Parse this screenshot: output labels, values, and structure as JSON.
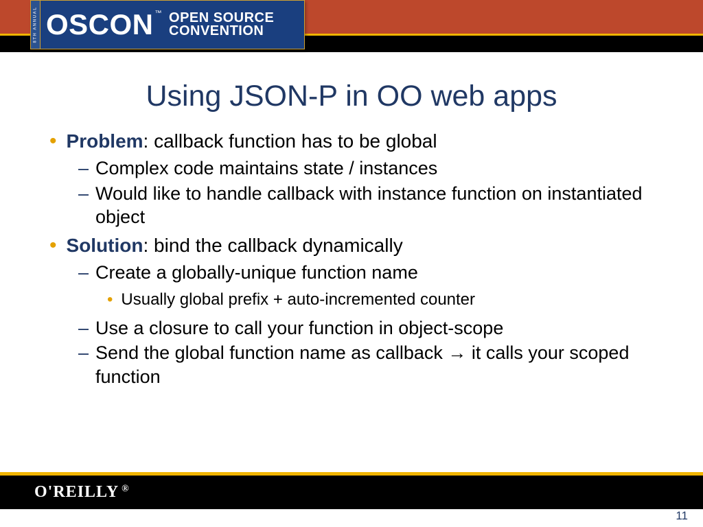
{
  "header": {
    "annual": "8TH ANNUAL",
    "logo_main": "OSCON",
    "logo_tm": "™",
    "logo_line1": "OPEN SOURCE",
    "logo_line2": "CONVENTION"
  },
  "title": "Using JSON-P in OO web apps",
  "body": {
    "b1_label": "Problem",
    "b1_text": ": callback function has to be global",
    "b1_s1": "Complex code maintains state / instances",
    "b1_s2": "Would like to handle callback with instance function on instantiated object",
    "b2_label": "Solution",
    "b2_text": ": bind the callback dynamically",
    "b2_s1": "Create a globally-unique function name",
    "b2_s1_a": "Usually global prefix + auto-incremented counter",
    "b2_s2": "Use a closure to call your function in object-scope",
    "b2_s3": "Send the global function name as callback → it calls your scoped function"
  },
  "footer": {
    "brand": "O'REILLY",
    "reg": "®",
    "page": "11"
  }
}
